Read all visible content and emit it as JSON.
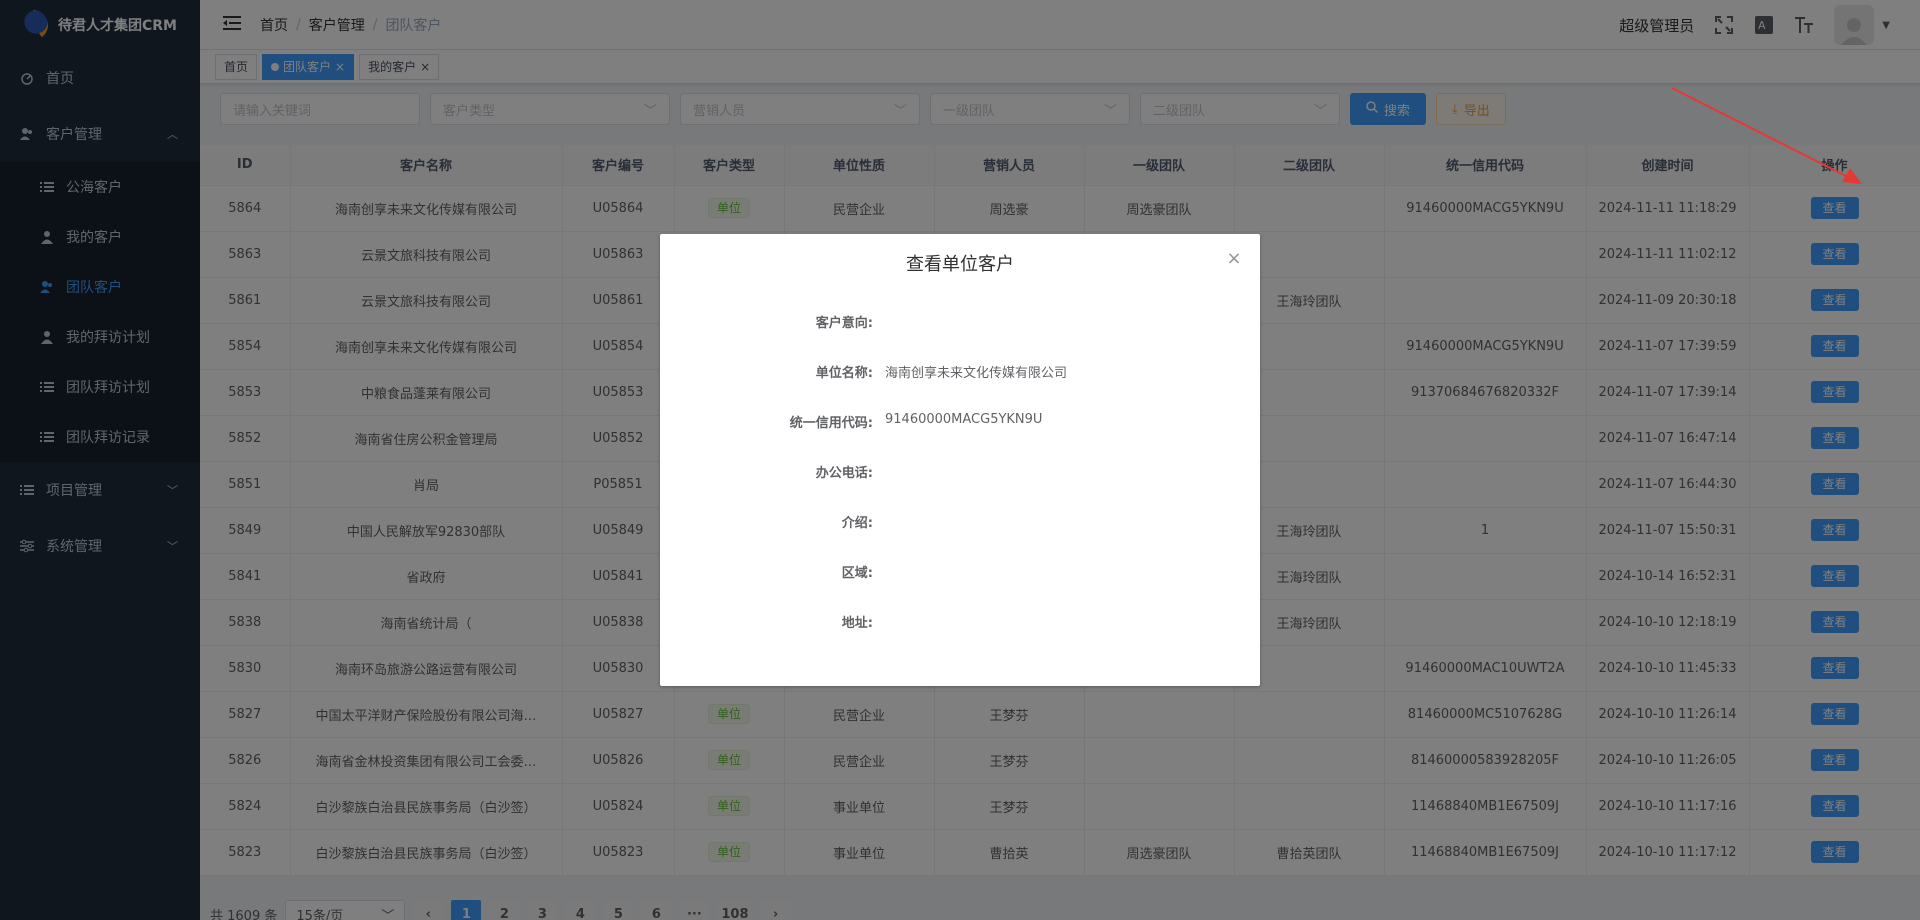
{
  "app": {
    "title": "待君人才集团CRM"
  },
  "sidebar": {
    "items": [
      {
        "label": "首页",
        "icon": "dashboard-icon"
      },
      {
        "label": "客户管理",
        "icon": "users-icon",
        "expanded": true,
        "children": [
          {
            "label": "公海客户",
            "icon": "list-icon"
          },
          {
            "label": "我的客户",
            "icon": "user-icon"
          },
          {
            "label": "团队客户",
            "icon": "team-icon",
            "active": true
          },
          {
            "label": "我的拜访计划",
            "icon": "user-icon"
          },
          {
            "label": "团队拜访计划",
            "icon": "list-icon"
          },
          {
            "label": "团队拜访记录",
            "icon": "list-icon"
          }
        ]
      },
      {
        "label": "项目管理",
        "icon": "list-icon"
      },
      {
        "label": "系统管理",
        "icon": "settings-icon"
      }
    ]
  },
  "header": {
    "breadcrumb": [
      "首页",
      "客户管理",
      "团队客户"
    ],
    "username": "超级管理员"
  },
  "tags": [
    {
      "label": "首页",
      "active": false
    },
    {
      "label": "团队客户",
      "active": true
    },
    {
      "label": "我的客户",
      "active": false
    }
  ],
  "filters": {
    "keyword_placeholder": "请输入关键词",
    "customer_type_placeholder": "客户类型",
    "sales_placeholder": "营销人员",
    "team1_placeholder": "一级团队",
    "team2_placeholder": "二级团队",
    "search_label": "搜索",
    "export_label": "导出"
  },
  "table": {
    "headers": [
      "ID",
      "客户名称",
      "客户编号",
      "客户类型",
      "单位性质",
      "营销人员",
      "一级团队",
      "二级团队",
      "统一信用代码",
      "创建时间",
      "操作"
    ],
    "action_label": "查看",
    "rows": [
      [
        "5864",
        "海南创享未来文化传媒有限公司",
        "U05864",
        "单位",
        "民营企业",
        "周选豪",
        "周选豪团队",
        "",
        "91460000MACG5YKN9U",
        "2024-11-11 11:18:29"
      ],
      [
        "5863",
        "云景文旅科技有限公司",
        "U05863",
        "",
        "",
        "",
        "",
        "",
        "",
        "2024-11-11 11:02:12"
      ],
      [
        "5861",
        "云景文旅科技有限公司",
        "U05861",
        "",
        "",
        "",
        "",
        "王海玲团队",
        "",
        "2024-11-09 20:30:18"
      ],
      [
        "5854",
        "海南创享未来文化传媒有限公司",
        "U05854",
        "",
        "",
        "",
        "",
        "",
        "91460000MACG5YKN9U",
        "2024-11-07 17:39:59"
      ],
      [
        "5853",
        "中粮食品蓬莱有限公司",
        "U05853",
        "",
        "",
        "",
        "",
        "",
        "91370684676820332F",
        "2024-11-07 17:39:14"
      ],
      [
        "5852",
        "海南省住房公积金管理局",
        "U05852",
        "",
        "",
        "",
        "",
        "",
        "",
        "2024-11-07 16:47:14"
      ],
      [
        "5851",
        "肖局",
        "P05851",
        "",
        "",
        "",
        "",
        "",
        "",
        "2024-11-07 16:44:30"
      ],
      [
        "5849",
        "中国人民解放军92830部队",
        "U05849",
        "",
        "",
        "",
        "",
        "王海玲团队",
        "1",
        "2024-11-07 15:50:31"
      ],
      [
        "5841",
        "省政府",
        "U05841",
        "",
        "",
        "",
        "",
        "王海玲团队",
        "",
        "2024-10-14 16:52:31"
      ],
      [
        "5838",
        "海南省统计局（",
        "U05838",
        "",
        "",
        "",
        "",
        "王海玲团队",
        "",
        "2024-10-10 12:18:19"
      ],
      [
        "5830",
        "海南环岛旅游公路运营有限公司",
        "U05830",
        "",
        "",
        "",
        "",
        "",
        "91460000MAC10UWT2A",
        "2024-10-10 11:45:33"
      ],
      [
        "5827",
        "中国太平洋财产保险股份有限公司海…",
        "U05827",
        "单位",
        "民营企业",
        "王梦芬",
        "",
        "",
        "81460000MC5107628G",
        "2024-10-10 11:26:14"
      ],
      [
        "5826",
        "海南省金林投资集团有限公司工会委…",
        "U05826",
        "单位",
        "民营企业",
        "王梦芬",
        "",
        "",
        "81460000583928205F",
        "2024-10-10 11:26:05"
      ],
      [
        "5824",
        "白沙黎族白治县民族事务局（白沙签）",
        "U05824",
        "单位",
        "事业单位",
        "王梦芬",
        "",
        "",
        "11468840MB1E67509J",
        "2024-10-10 11:17:16"
      ],
      [
        "5823",
        "白沙黎族白治县民族事务局（白沙签）",
        "U05823",
        "单位",
        "事业单位",
        "曹拾英",
        "周选豪团队",
        "曹拾英团队",
        "11468840MB1E67509J",
        "2024-10-10 11:17:12"
      ]
    ]
  },
  "pagination": {
    "total": "共 1609 条",
    "page_size": "15条/页",
    "pages": [
      "1",
      "2",
      "3",
      "4",
      "5",
      "6",
      "···",
      "108"
    ],
    "current": "1"
  },
  "modal": {
    "title": "查看单位客户",
    "fields": [
      {
        "label": "客户意向:",
        "value": ""
      },
      {
        "label": "单位名称:",
        "value": "海南创享未来文化传媒有限公司"
      },
      {
        "label": "统一信用代码:",
        "value": "91460000MACG5YKN9U"
      },
      {
        "label": "办公电话:",
        "value": ""
      },
      {
        "label": "介绍:",
        "value": ""
      },
      {
        "label": "区域:",
        "value": ""
      },
      {
        "label": "地址:",
        "value": ""
      }
    ]
  },
  "colors": {
    "sidebar_bg": "#1f2d3d",
    "primary": "#409eff",
    "annotation_arrow": "#e53935"
  }
}
